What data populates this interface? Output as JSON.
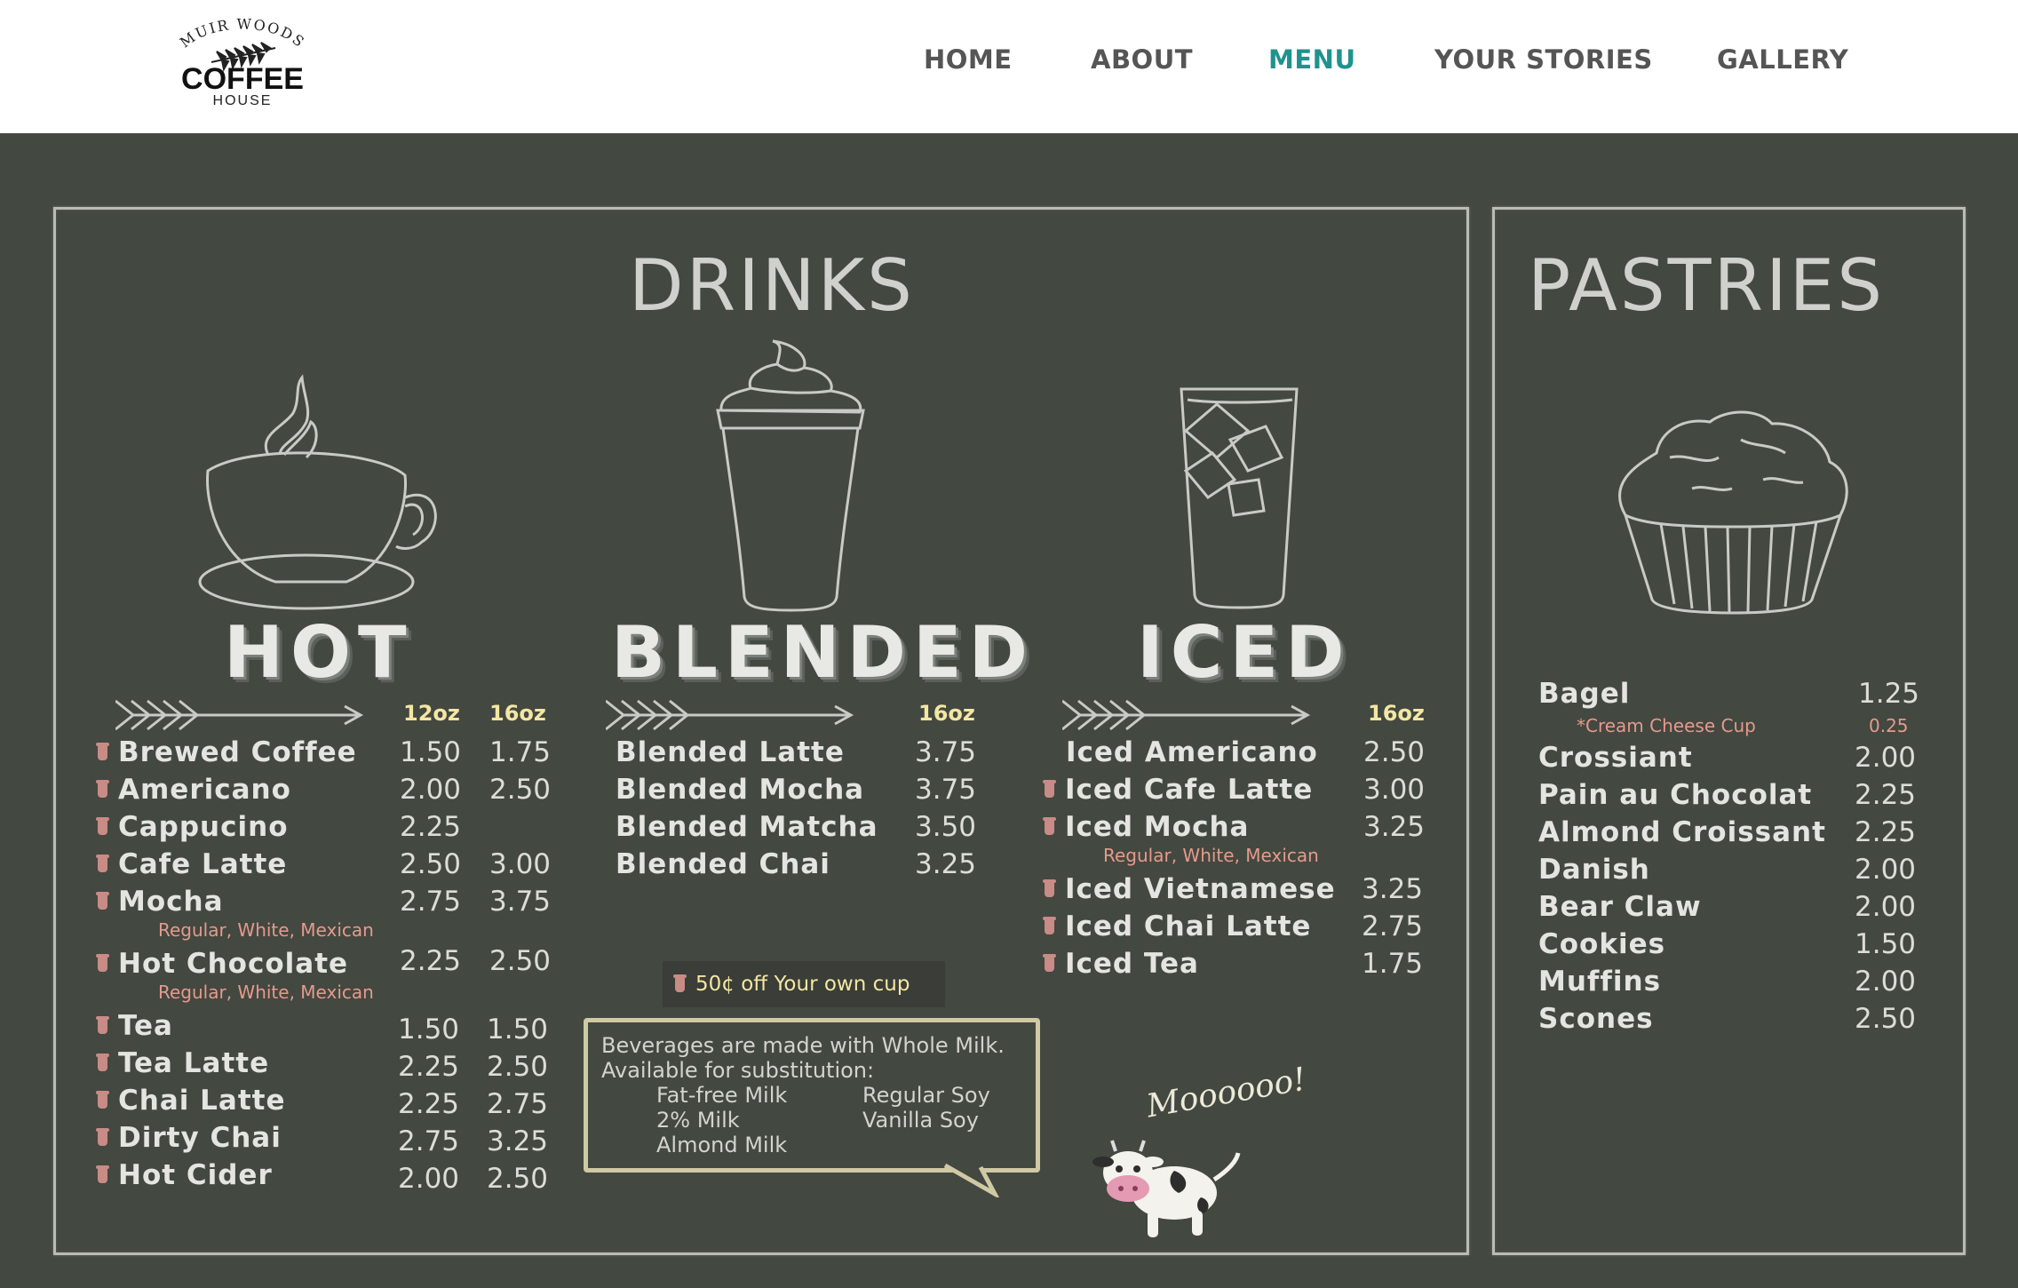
{
  "header": {
    "logo": {
      "arc_text": "MUIR WOODS",
      "name": "COFFEE",
      "sub": "HOUSE"
    },
    "nav": [
      {
        "label": "HOME",
        "active": false
      },
      {
        "label": "ABOUT",
        "active": false
      },
      {
        "label": "MENU",
        "active": true
      },
      {
        "label": "YOUR STORIES",
        "active": false
      },
      {
        "label": "GALLERY",
        "active": false
      }
    ],
    "active_color": "#1e938e"
  },
  "drinks": {
    "title": "DRINKS",
    "hot": {
      "title": "HOT",
      "sizes": [
        "12oz",
        "16oz"
      ],
      "items": [
        {
          "name": "Brewed Coffee",
          "p1": "1.50",
          "p2": "1.75",
          "own_cup": true
        },
        {
          "name": "Americano",
          "p1": "2.00",
          "p2": "2.50",
          "own_cup": true
        },
        {
          "name": "Cappucino",
          "p1": "2.25",
          "p2": "",
          "own_cup": true
        },
        {
          "name": "Cafe Latte",
          "p1": "2.50",
          "p2": "3.00",
          "own_cup": true
        },
        {
          "name": "Mocha",
          "p1": "2.75",
          "p2": "3.75",
          "own_cup": true,
          "note": "Regular, White, Mexican"
        },
        {
          "name": "Hot Chocolate",
          "p1": "2.25",
          "p2": "2.50",
          "own_cup": true,
          "note": "Regular, White, Mexican"
        },
        {
          "name": "Tea",
          "p1": "1.50",
          "p2": "1.50",
          "own_cup": true
        },
        {
          "name": "Tea Latte",
          "p1": "2.25",
          "p2": "2.50",
          "own_cup": true
        },
        {
          "name": "Chai Latte",
          "p1": "2.25",
          "p2": "2.75",
          "own_cup": true
        },
        {
          "name": "Dirty Chai",
          "p1": "2.75",
          "p2": "3.25",
          "own_cup": true
        },
        {
          "name": "Hot Cider",
          "p1": "2.00",
          "p2": "2.50",
          "own_cup": true
        }
      ]
    },
    "blended": {
      "title": "BLENDED",
      "size": "16oz",
      "items": [
        {
          "name": "Blended Latte",
          "price": "3.75"
        },
        {
          "name": "Blended Mocha",
          "price": "3.75"
        },
        {
          "name": "Blended Matcha",
          "price": "3.50"
        },
        {
          "name": "Blended Chai",
          "price": "3.25"
        }
      ]
    },
    "iced": {
      "title": "ICED",
      "size": "16oz",
      "items": [
        {
          "name": "Iced Americano",
          "price": "2.50",
          "own_cup": false
        },
        {
          "name": "Iced Cafe Latte",
          "price": "3.00",
          "own_cup": true
        },
        {
          "name": "Iced Mocha",
          "price": "3.25",
          "own_cup": true,
          "note": "Regular, White, Mexican"
        },
        {
          "name": "Iced Vietnamese",
          "price": "3.25",
          "own_cup": true
        },
        {
          "name": "Iced Chai Latte",
          "price": "2.75",
          "own_cup": true
        },
        {
          "name": "Iced Tea",
          "price": "1.75",
          "own_cup": true
        }
      ]
    },
    "promo": "50¢ off Your own cup",
    "milk": {
      "line1": "Beverages are made with Whole Milk.",
      "line2": "Available for substitution:",
      "col1": [
        "Fat-free Milk",
        "2% Milk",
        "Almond Milk"
      ],
      "col2": [
        "Regular Soy",
        "Vanilla Soy"
      ]
    },
    "moo": "Moooooo!"
  },
  "pastries": {
    "title": "PASTRIES",
    "items": [
      {
        "name": "Bagel",
        "price": "1.25",
        "sub": {
          "name": "*Cream Cheese Cup",
          "price": "0.25"
        }
      },
      {
        "name": "Crossiant",
        "price": "2.00"
      },
      {
        "name": "Pain au Chocolat",
        "price": "2.25"
      },
      {
        "name": "Almond Croissant",
        "price": "2.25"
      },
      {
        "name": "Danish",
        "price": "2.00"
      },
      {
        "name": "Bear Claw",
        "price": "2.00"
      },
      {
        "name": "Cookies",
        "price": "1.50"
      },
      {
        "name": "Muffins",
        "price": "2.00"
      },
      {
        "name": "Scones",
        "price": "2.50"
      }
    ]
  },
  "colors": {
    "chalkboard": "#434840",
    "size_label": "#f4e6a3",
    "note": "#e59a8c",
    "cup_icon": "#c98b86"
  }
}
